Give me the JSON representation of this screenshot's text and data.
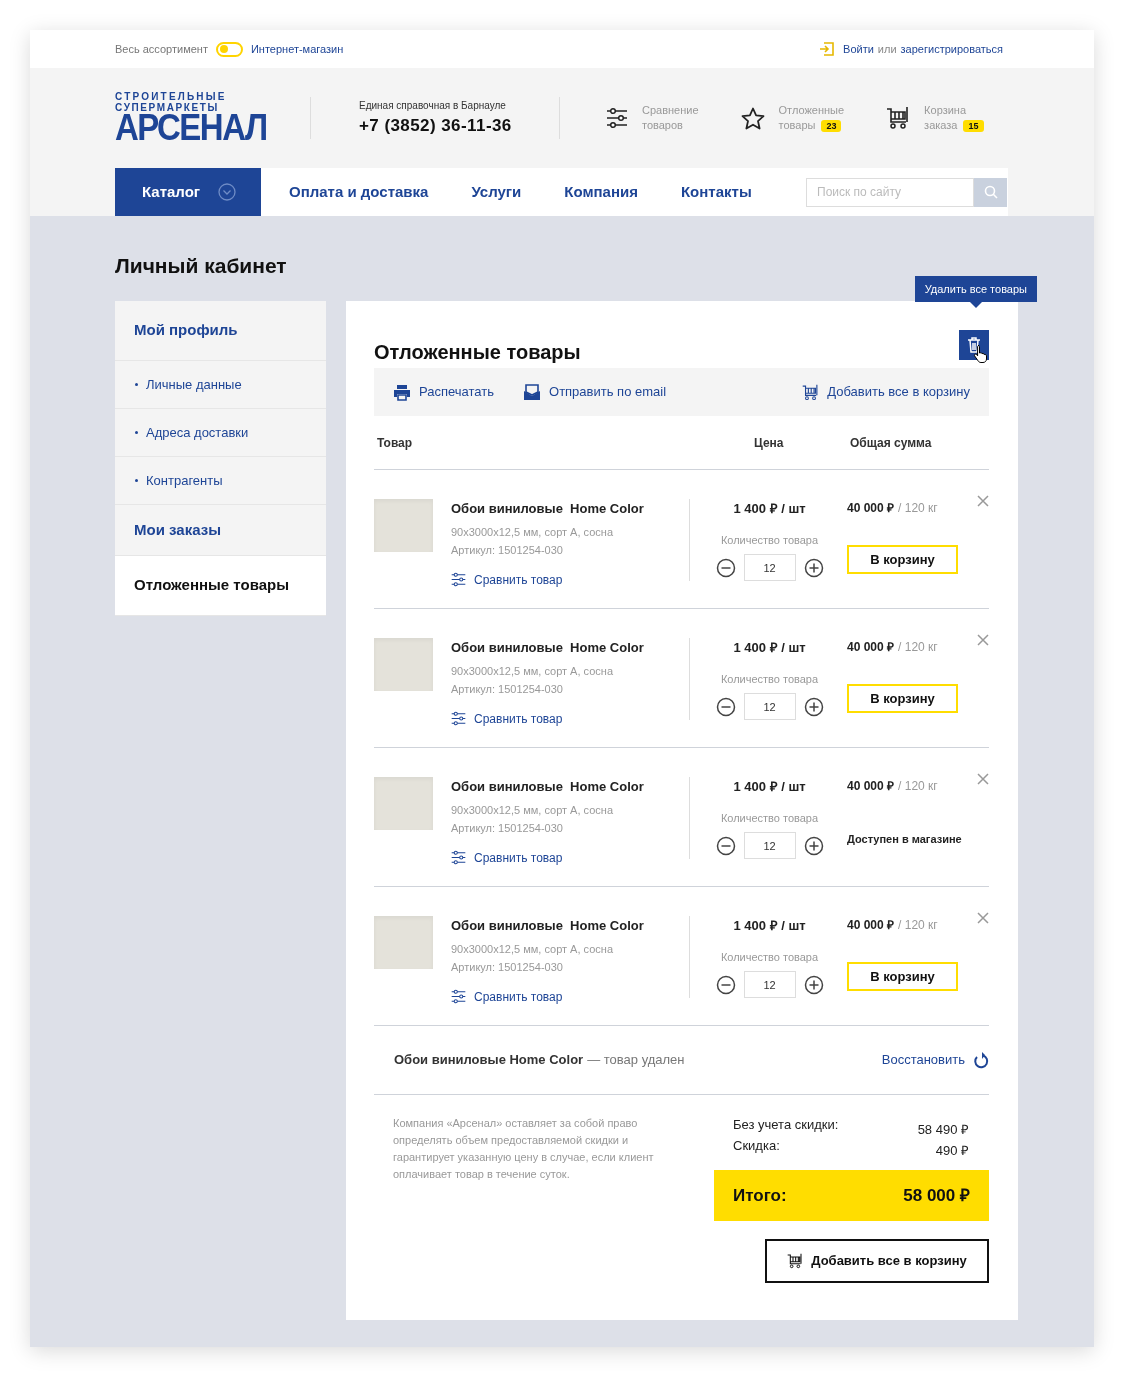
{
  "top_bar": {
    "assortment_label": "Весь ассортимент",
    "toggle": {
      "on": false
    },
    "store_label": "Интернет-магазин",
    "login": "Войти",
    "or": "или",
    "register": "зарегистрироваться"
  },
  "header": {
    "logo": {
      "line_1": "СТРОИТЕЛЬНЫЕ",
      "line_2": "СУПЕРМАРКЕТЫ",
      "name": "АРСЕНАЛ"
    },
    "phone": {
      "caption": "Единая справочная в Барнауле",
      "number": "+7 (3852) 36-11-36"
    },
    "shortcuts": [
      {
        "kind": "compare",
        "line_1": "Сравнение",
        "line_2": "товаров"
      },
      {
        "kind": "favorites",
        "line_1": "Отложенные",
        "line_2": "товары",
        "badge": "23"
      },
      {
        "kind": "cart",
        "line_1": "Корзина",
        "line_2": "заказа",
        "badge": "15"
      }
    ]
  },
  "nav": {
    "catalog": "Каталог",
    "items": [
      "Оплата и доставка",
      "Услуги",
      "Компания",
      "Контакты"
    ],
    "search": {
      "placeholder": "Поиск по сайту"
    }
  },
  "page_title": "Личный кабинет",
  "sidebar": {
    "items": [
      {
        "kind": "section",
        "label": "Мой профиль",
        "selected": false
      },
      {
        "kind": "sub",
        "label": "Личные данные",
        "selected": false
      },
      {
        "kind": "sub",
        "label": "Адреса доставки",
        "selected": false
      },
      {
        "kind": "sub",
        "label": "Контрагенты",
        "selected": false
      },
      {
        "kind": "section",
        "label": "Мои заказы",
        "selected": false
      },
      {
        "kind": "section",
        "label": "Отложенные товары",
        "selected": true
      }
    ]
  },
  "panel": {
    "title": "Отложенные товары",
    "tooltip": "Удалить все товары",
    "toolbar": [
      {
        "kind": "print",
        "label": "Распечатать"
      },
      {
        "kind": "email",
        "label": "Отправить по email"
      },
      {
        "kind": "cart",
        "label": "Добавить все в корзину"
      }
    ],
    "columns": [
      "Товар",
      "Цена",
      "Общая сумма"
    ],
    "products": [
      {
        "name": "Обои виниловые  Home Color",
        "specs": "90x3000x12,5 мм, сорт А, сосна",
        "sku": "Артикул: 1501254-030",
        "compare": "Сравнить товар",
        "price": "1 400 ₽ / шт",
        "qty_label": "Количество товара",
        "qty": "12",
        "total": "40 000 ₽",
        "weight": "/ 120 кг",
        "action": {
          "kind": "button",
          "label": "В корзину"
        }
      },
      {
        "name": "Обои виниловые  Home Color",
        "specs": "90x3000x12,5 мм, сорт А, сосна",
        "sku": "Артикул: 1501254-030",
        "compare": "Сравнить товар",
        "price": "1 400 ₽ / шт",
        "qty_label": "Количество товара",
        "qty": "12",
        "total": "40 000 ₽",
        "weight": "/ 120 кг",
        "action": {
          "kind": "button",
          "label": "В корзину"
        }
      },
      {
        "name": "Обои виниловые  Home Color",
        "specs": "90x3000x12,5 мм, сорт А, сосна",
        "sku": "Артикул: 1501254-030",
        "compare": "Сравнить товар",
        "price": "1 400 ₽ / шт",
        "qty_label": "Количество товара",
        "qty": "12",
        "total": "40 000 ₽",
        "weight": "/ 120 кг",
        "action": {
          "kind": "note",
          "label": "Доступен в магазине"
        }
      },
      {
        "name": "Обои виниловые  Home Color",
        "specs": "90x3000x12,5 мм, сорт А, сосна",
        "sku": "Артикул: 1501254-030",
        "compare": "Сравнить товар",
        "price": "1 400 ₽ / шт",
        "qty_label": "Количество товара",
        "qty": "12",
        "total": "40 000 ₽",
        "weight": "/ 120 кг",
        "action": {
          "kind": "button",
          "label": "В корзину"
        }
      }
    ],
    "deleted": {
      "name": "Обои виниловые Home Color",
      "status": "— товар удален",
      "restore": "Восстановить"
    },
    "note": "Компания «Арсенал» оставляет за собой право определять объем предоставляемой скидки и гарантирует указанную цену в случае, если клиент оплачивает товар в течение суток.",
    "summary": {
      "subtotal_label": "Без учета скидки:",
      "subtotal": "58 490 ₽",
      "discount_label": "Скидка:",
      "discount": "490 ₽",
      "total_label": "Итого:",
      "total": "58 000 ₽"
    },
    "add_all": "Добавить все в корзину"
  }
}
